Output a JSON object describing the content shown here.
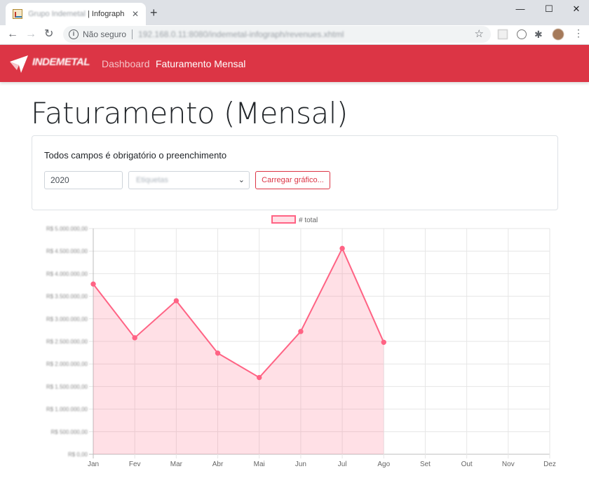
{
  "browser": {
    "tab_title_blur": "Grupo Indemetal",
    "tab_title": " | Infograph",
    "tab_close": "✕",
    "new_tab": "+",
    "window_min": "—",
    "window_max": "☐",
    "window_close": "✕",
    "back": "←",
    "forward": "→",
    "reload": "↻",
    "info_glyph": "i",
    "security_label": "Não seguro",
    "url": "192.168.0.11:8080/indemetal-infograph/revenues.xhtml",
    "star": "☆",
    "extensions_glyph": "✱",
    "menu": "⋮"
  },
  "navbar": {
    "logo_text": "INDEMETAL",
    "links": [
      "Dashboard",
      "Faturamento Mensal"
    ],
    "active_index": 1,
    "color": "#dc3545"
  },
  "page": {
    "title": "Faturamento (Mensal)"
  },
  "form": {
    "note": "Todos campos é obrigatório o preenchimento",
    "year_value": "2020",
    "company_value": "Etiquetas",
    "load_button": "Carregar gráfico..."
  },
  "chart_data": {
    "type": "area",
    "legend": "# total",
    "categories": [
      "Jan",
      "Fev",
      "Mar",
      "Abr",
      "Mai",
      "Jun",
      "Jul",
      "Ago",
      "Set",
      "Out",
      "Nov",
      "Dez"
    ],
    "y_ticks": [
      "R$ 5.000.000,00",
      "R$ 4.500.000,00",
      "R$ 4.000.000,00",
      "R$ 3.500.000,00",
      "R$ 3.000.000,00",
      "R$ 2.500.000,00",
      "R$ 2.000.000,00",
      "R$ 1.500.000,00",
      "R$ 1.000.000,00",
      "R$ 500.000,00",
      "R$ 0,00"
    ],
    "ylim": [
      0,
      5000000
    ],
    "series": [
      {
        "name": "# total",
        "values": [
          3770000,
          2580000,
          3400000,
          2240000,
          1700000,
          2720000,
          4560000,
          2480000,
          null,
          null,
          null,
          null
        ],
        "color": "#ff6384",
        "fill": "rgba(255,99,132,0.2)"
      }
    ],
    "grid": true,
    "legend_position": "top"
  }
}
